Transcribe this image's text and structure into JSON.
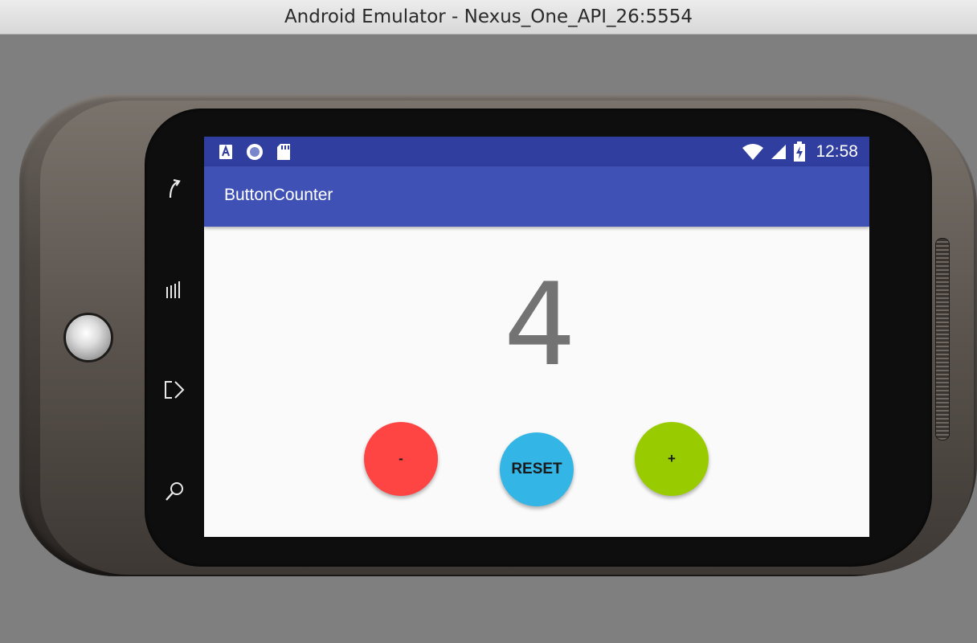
{
  "window": {
    "title": "Android Emulator - Nexus_One_API_26:5554"
  },
  "hardware_keys": [
    {
      "name": "back-key-icon"
    },
    {
      "name": "menu-key-icon"
    },
    {
      "name": "home-key-icon"
    },
    {
      "name": "search-key-icon"
    }
  ],
  "status_bar": {
    "left_icons": [
      "accessibility-icon",
      "sync-circle-icon",
      "sd-card-icon"
    ],
    "right_icons": [
      "wifi-icon",
      "cell-signal-icon",
      "battery-charging-icon"
    ],
    "time": "12:58"
  },
  "app_bar": {
    "title": "ButtonCounter"
  },
  "counter": {
    "value": "4"
  },
  "buttons": {
    "minus_label": "-",
    "reset_label": "RESET",
    "plus_label": "+"
  },
  "colors": {
    "status_bar": "#303f9f",
    "app_bar": "#3f51b5",
    "minus_button": "#ff4444",
    "reset_button": "#33b5e5",
    "plus_button": "#99cc00",
    "counter_text": "#737373"
  }
}
